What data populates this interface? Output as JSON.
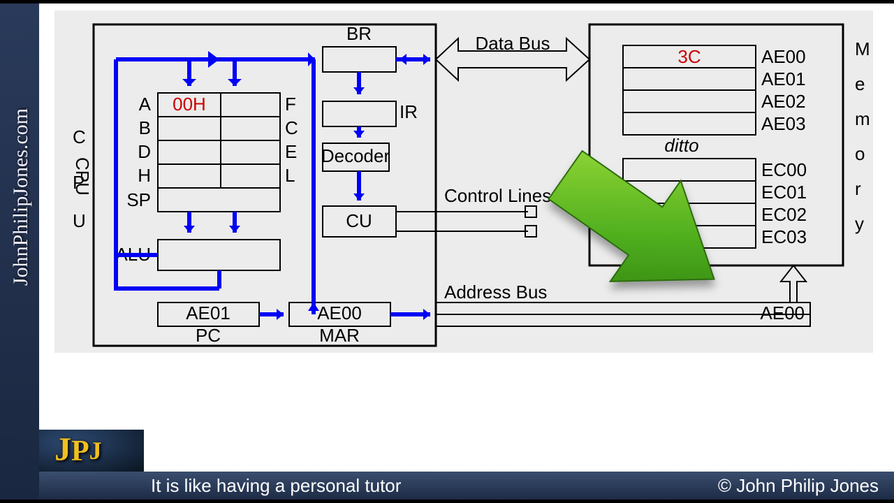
{
  "branding": {
    "website": "JohnPhilipJones.com",
    "logo": "JPJ",
    "copyright": "© John Philip Jones"
  },
  "caption": "It is like having a personal tutor",
  "diagram": {
    "cpu": {
      "label": "CPU",
      "registers": {
        "left": [
          "A",
          "B",
          "D",
          "H",
          "SP"
        ],
        "right": [
          "F",
          "C",
          "E",
          "L"
        ],
        "a_value": "00H"
      },
      "alu": "ALU",
      "br": "BR",
      "ir": "IR",
      "decoder": "Decoder",
      "cu": "CU",
      "pc": {
        "label": "PC",
        "value": "AE01"
      },
      "mar": {
        "label": "MAR",
        "value": "AE00"
      }
    },
    "buses": {
      "data": "Data Bus",
      "control": "Control Lines",
      "address": "Address Bus",
      "address_value": "AE00"
    },
    "memory": {
      "label": "Memory",
      "block1": {
        "addresses": [
          "AE00",
          "AE01",
          "AE02",
          "AE03"
        ],
        "row0_value": "3C"
      },
      "ditto": "ditto",
      "block2": {
        "addresses": [
          "EC00",
          "EC01",
          "EC02",
          "EC03"
        ]
      }
    }
  }
}
